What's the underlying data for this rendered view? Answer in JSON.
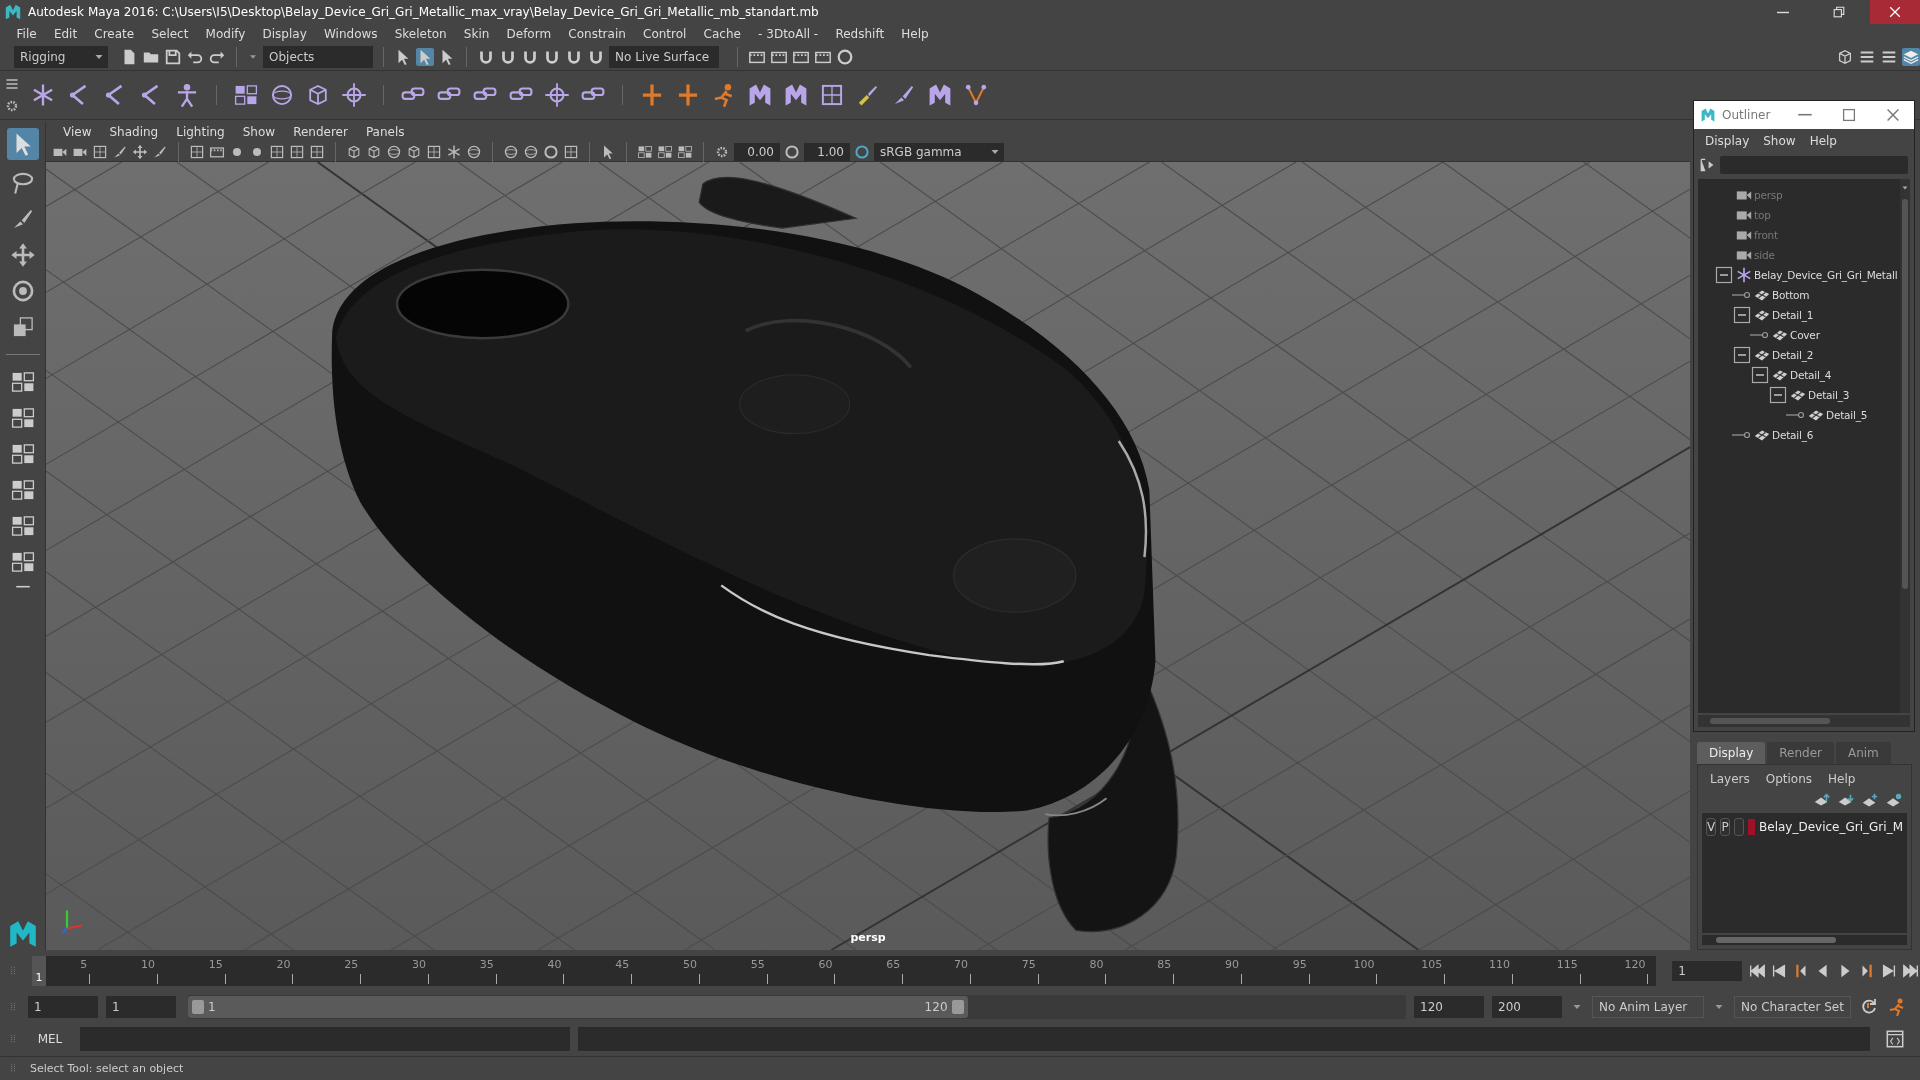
{
  "window": {
    "title": "Autodesk Maya 2016: C:\\Users\\I5\\Desktop\\Belay_Device_Gri_Gri_Metallic_max_vray\\Belay_Device_Gri_Gri_Metallic_mb_standart.mb"
  },
  "menu_bar": [
    "File",
    "Edit",
    "Create",
    "Select",
    "Modify",
    "Display",
    "Windows",
    "Skeleton",
    "Skin",
    "Deform",
    "Constrain",
    "Control",
    "Cache",
    "- 3DtoAll -",
    "Redshift",
    "Help"
  ],
  "status_line": {
    "menu_set": "Rigging",
    "selection_mode": "Objects",
    "live_surface": "No Live Surface"
  },
  "viewport": {
    "menus": [
      "View",
      "Shading",
      "Lighting",
      "Show",
      "Renderer",
      "Panels"
    ],
    "gamma_value": "0.00",
    "exposure_value": "1.00",
    "color_space": "sRGB gamma",
    "camera": "persp"
  },
  "outliner": {
    "title": "Outliner",
    "menus": [
      "Display",
      "Show",
      "Help"
    ],
    "items": [
      {
        "label": "persp",
        "kind": "camera"
      },
      {
        "label": "top",
        "kind": "camera"
      },
      {
        "label": "front",
        "kind": "camera"
      },
      {
        "label": "side",
        "kind": "camera"
      },
      {
        "label": "Belay_Device_Gri_Gri_Metall",
        "kind": "group",
        "expanded": true,
        "children": [
          {
            "label": "Bottom",
            "kind": "mesh"
          },
          {
            "label": "Detail_1",
            "kind": "mesh",
            "expanded": true,
            "children": [
              {
                "label": "Cover",
                "kind": "mesh"
              }
            ]
          },
          {
            "label": "Detail_2",
            "kind": "mesh",
            "expanded": true,
            "children": [
              {
                "label": "Detail_4",
                "kind": "mesh",
                "expanded": true,
                "children": [
                  {
                    "label": "Detail_3",
                    "kind": "mesh",
                    "expanded": true,
                    "children": [
                      {
                        "label": "Detail_5",
                        "kind": "mesh"
                      }
                    ]
                  }
                ]
              }
            ]
          },
          {
            "label": "Detail_6",
            "kind": "mesh"
          }
        ]
      }
    ]
  },
  "layer_editor": {
    "tabs": [
      {
        "label": "Display",
        "selected": true
      },
      {
        "label": "Render",
        "selected": false
      },
      {
        "label": "Anim",
        "selected": false
      }
    ],
    "menus": [
      "Layers",
      "Options",
      "Help"
    ],
    "layers": [
      {
        "visibility": "V",
        "playback": "P",
        "color": "#a0102a",
        "name": "Belay_Device_Gri_Gri_M"
      }
    ]
  },
  "time_slider": {
    "ticks": [
      "5",
      "10",
      "15",
      "20",
      "25",
      "30",
      "35",
      "40",
      "45",
      "50",
      "55",
      "60",
      "65",
      "70",
      "75",
      "80",
      "85",
      "90",
      "95",
      "100",
      "105",
      "110",
      "115",
      "120"
    ],
    "current_frame_marker": "1",
    "level": 0,
    "current_frame": "1"
  },
  "range_slider": {
    "start": "1",
    "playback_start": "1",
    "range_start": "1",
    "range_end": "120",
    "level": 0.64,
    "playback_end": "120",
    "end": "200",
    "anim_layer": "No Anim Layer",
    "character_set": "No Character Set"
  },
  "command_line": {
    "language": "MEL"
  },
  "help_line": "Select Tool: select an object"
}
